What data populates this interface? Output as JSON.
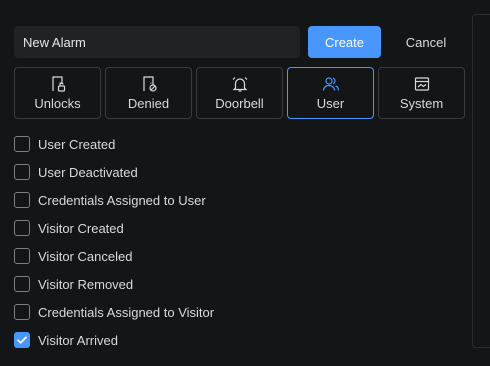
{
  "form": {
    "name_value": "New Alarm",
    "create_label": "Create",
    "cancel_label": "Cancel"
  },
  "tabs": [
    {
      "label": "Unlocks",
      "icon": "door-unlock-icon",
      "active": false
    },
    {
      "label": "Denied",
      "icon": "door-denied-icon",
      "active": false
    },
    {
      "label": "Doorbell",
      "icon": "bell-icon",
      "active": false
    },
    {
      "label": "User",
      "icon": "users-icon",
      "active": true
    },
    {
      "label": "System",
      "icon": "window-icon",
      "active": false
    }
  ],
  "events": [
    {
      "label": "User Created",
      "checked": false
    },
    {
      "label": "User Deactivated",
      "checked": false
    },
    {
      "label": "Credentials Assigned to User",
      "checked": false
    },
    {
      "label": "Visitor Created",
      "checked": false
    },
    {
      "label": "Visitor Canceled",
      "checked": false
    },
    {
      "label": "Visitor Removed",
      "checked": false
    },
    {
      "label": "Credentials Assigned to Visitor",
      "checked": false
    },
    {
      "label": "Visitor Arrived",
      "checked": true
    }
  ],
  "colors": {
    "accent": "#4797ff",
    "background": "#141517",
    "input_bg": "#202226",
    "border": "#3a3c41"
  }
}
